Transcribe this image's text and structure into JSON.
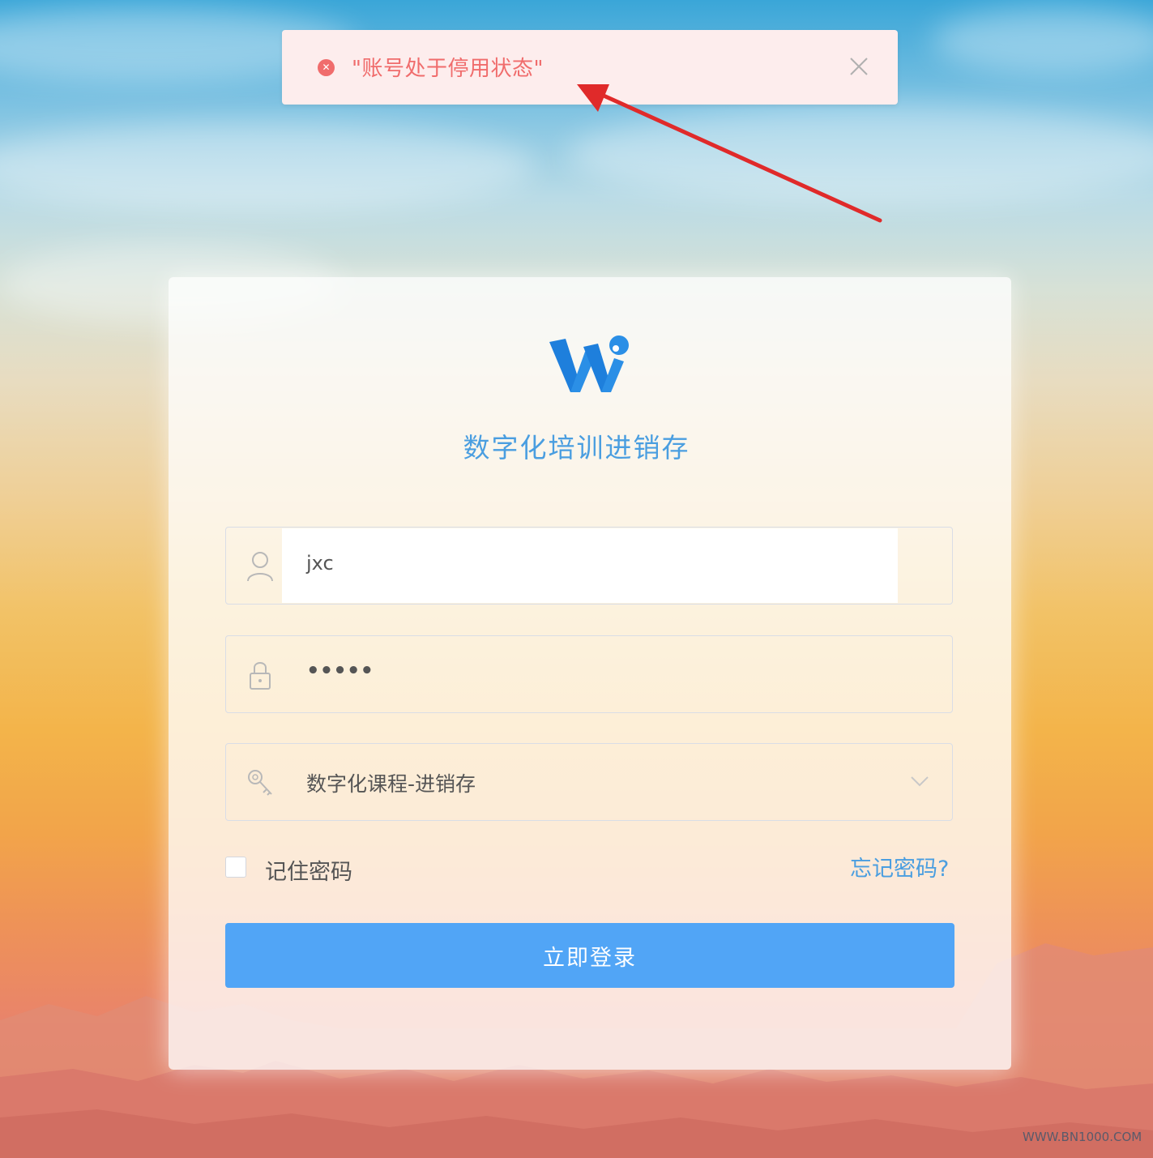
{
  "toast": {
    "message": "\"账号处于停用状态\"",
    "type_icon": "error-circle-icon",
    "close_icon": "close-icon",
    "color": "#f06c6c"
  },
  "app": {
    "logo_icon": "w-logo-icon",
    "title": "数字化培训进销存",
    "brand_color": "#4a9ee0"
  },
  "login_form": {
    "username": {
      "icon": "user-icon",
      "value": "jxc"
    },
    "password": {
      "icon": "lock-icon",
      "value": "•••••"
    },
    "course_select": {
      "icon": "key-icon",
      "selected": "数字化课程-进销存",
      "arrow_icon": "chevron-down-icon"
    },
    "remember_label": "记住密码",
    "remember_checked": false,
    "forgot_link": "忘记密码?",
    "submit_label": "立即登录",
    "submit_color": "#51a5f6"
  },
  "watermark": "WWW.BN1000.COM"
}
